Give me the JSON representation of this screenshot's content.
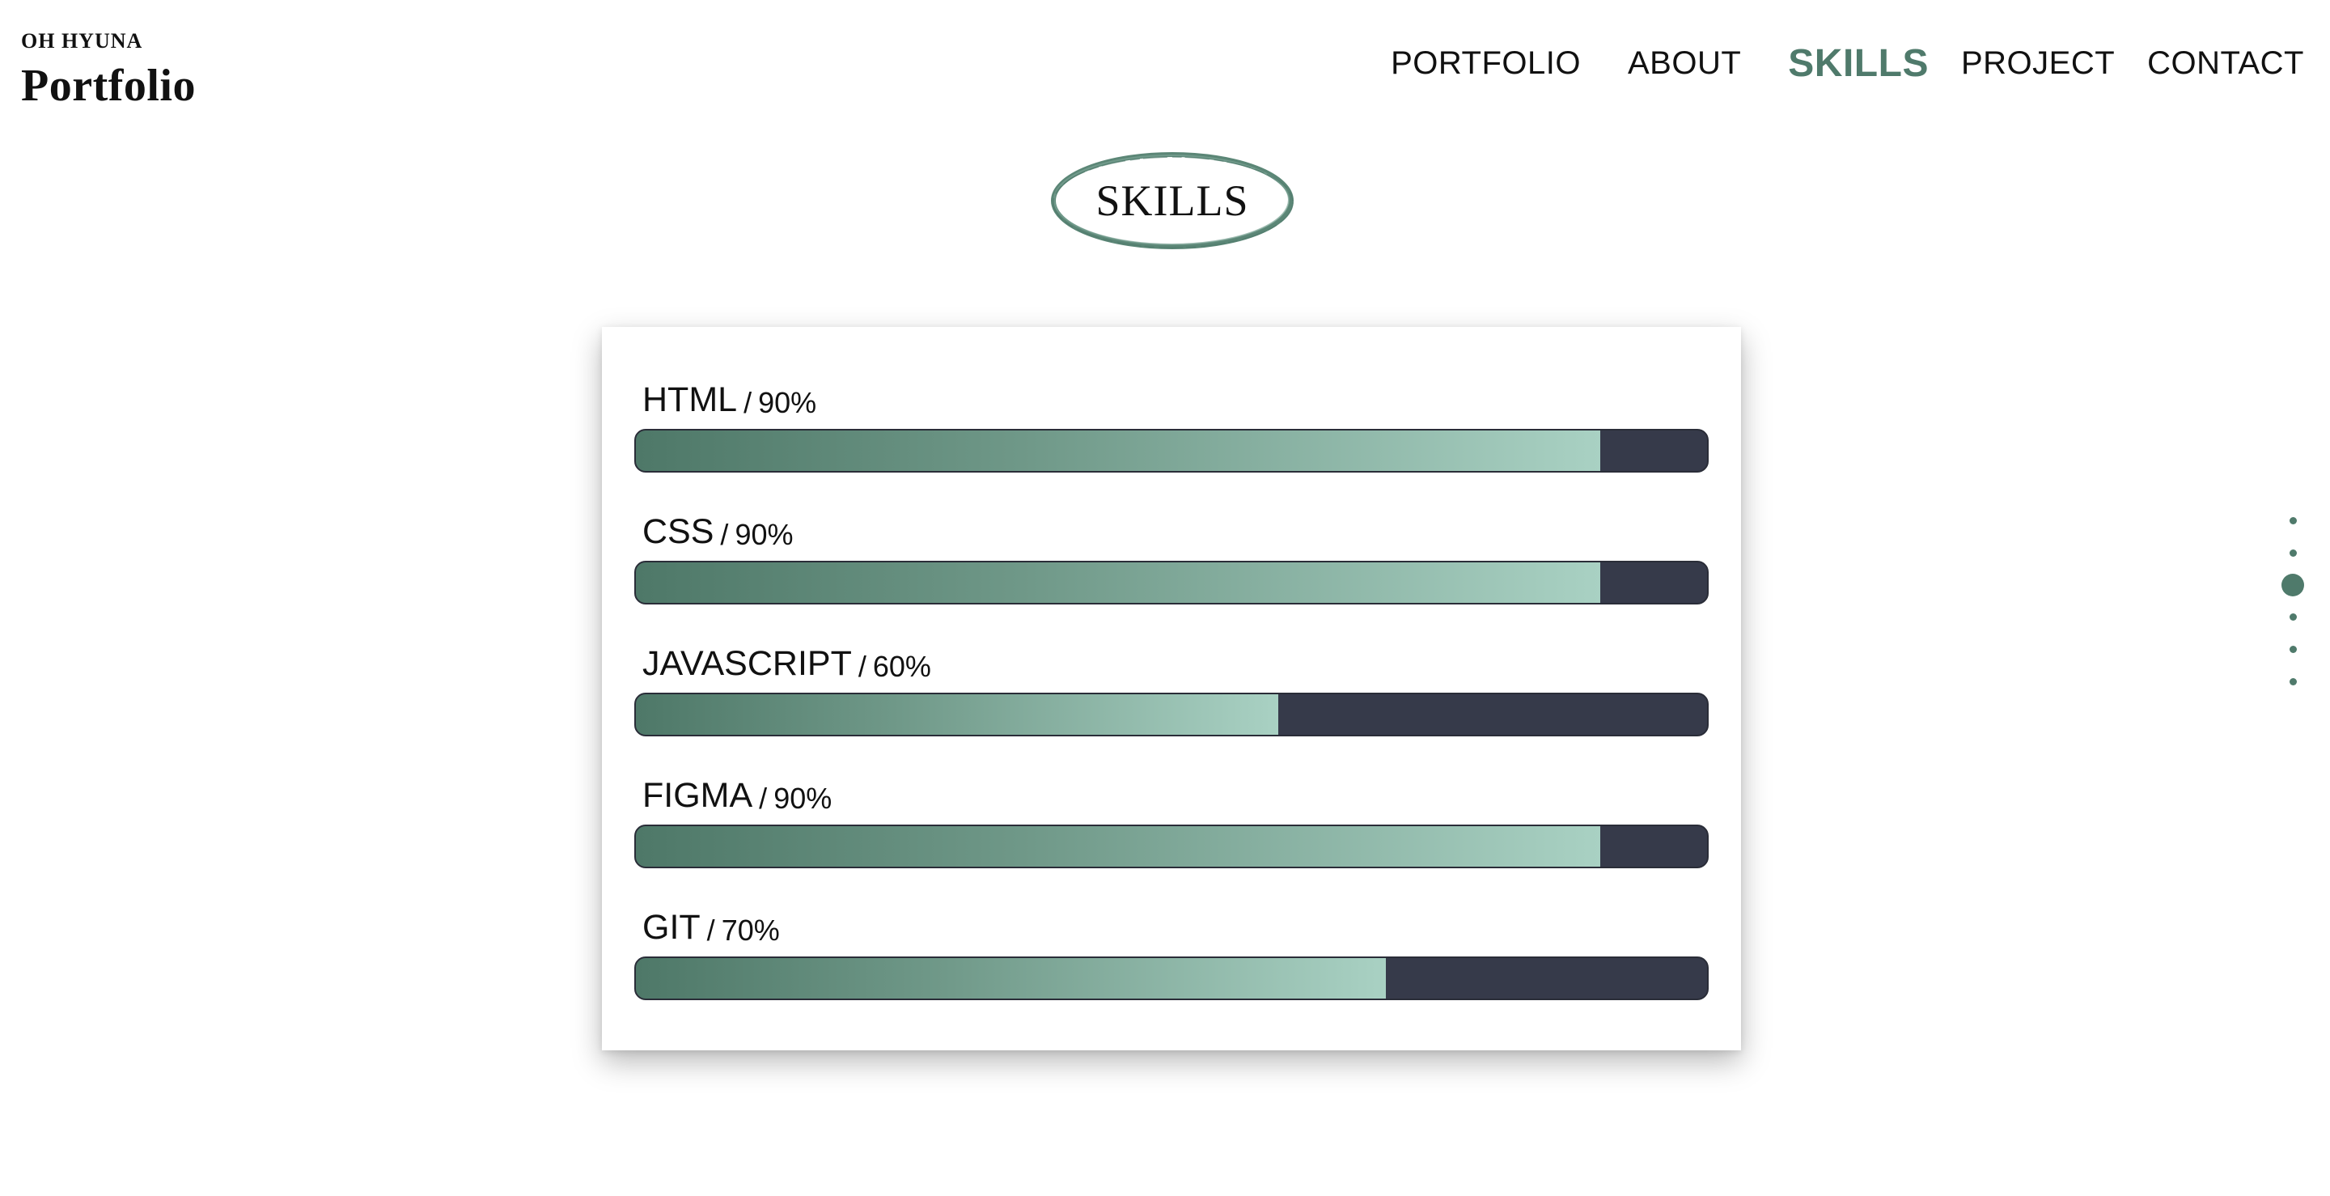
{
  "logo": {
    "subtitle": "OH HYUNA",
    "title": "Portfolio"
  },
  "nav": {
    "items": [
      {
        "label": "PORTFOLIO"
      },
      {
        "label": "ABOUT"
      },
      {
        "label": "SKILLS"
      },
      {
        "label": "PROJECT"
      },
      {
        "label": "CONTACT"
      }
    ],
    "active_index": 2
  },
  "section": {
    "title": "SKILLS"
  },
  "skills": [
    {
      "name": "HTML",
      "separator": "/",
      "percent_label": "90%",
      "percent": 90
    },
    {
      "name": "CSS",
      "separator": "/",
      "percent_label": "90%",
      "percent": 90
    },
    {
      "name": "JAVASCRIPT",
      "separator": "/",
      "percent_label": "60%",
      "percent": 60
    },
    {
      "name": "FIGMA",
      "separator": "/",
      "percent_label": "90%",
      "percent": 90
    },
    {
      "name": "GIT",
      "separator": "/",
      "percent_label": "70%",
      "percent": 70
    }
  ],
  "pager": {
    "count": 6,
    "active_index": 2
  },
  "colors": {
    "accent": "#4f7a6b",
    "bar_track": "#363a4a",
    "bar_fill_start": "#4e7868",
    "bar_fill_end": "#a9d1c3"
  }
}
